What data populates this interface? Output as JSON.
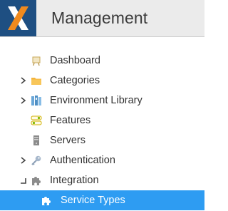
{
  "header": {
    "title": "Management",
    "logo": "x-logo",
    "colors": {
      "logo_bg": "#1e4f82",
      "logo_orange": "#f08a1e",
      "header_bg": "#ebebeb"
    }
  },
  "nav": {
    "items": [
      {
        "label": "Dashboard",
        "icon": "dashboard-icon",
        "expander": "none"
      },
      {
        "label": "Categories",
        "icon": "folder-icon",
        "expander": "collapsed"
      },
      {
        "label": "Environment Library",
        "icon": "library-icon",
        "expander": "collapsed"
      },
      {
        "label": "Features",
        "icon": "features-icon",
        "expander": "none"
      },
      {
        "label": "Servers",
        "icon": "server-icon",
        "expander": "none"
      },
      {
        "label": "Authentication",
        "icon": "key-icon",
        "expander": "collapsed"
      },
      {
        "label": "Integration",
        "icon": "puzzle-icon",
        "expander": "expanded"
      }
    ],
    "sub_items": [
      {
        "label": "Service Types",
        "icon": "puzzle-piece-icon",
        "selected": true
      }
    ],
    "colors": {
      "selected_bg": "#2e9cf2"
    }
  }
}
